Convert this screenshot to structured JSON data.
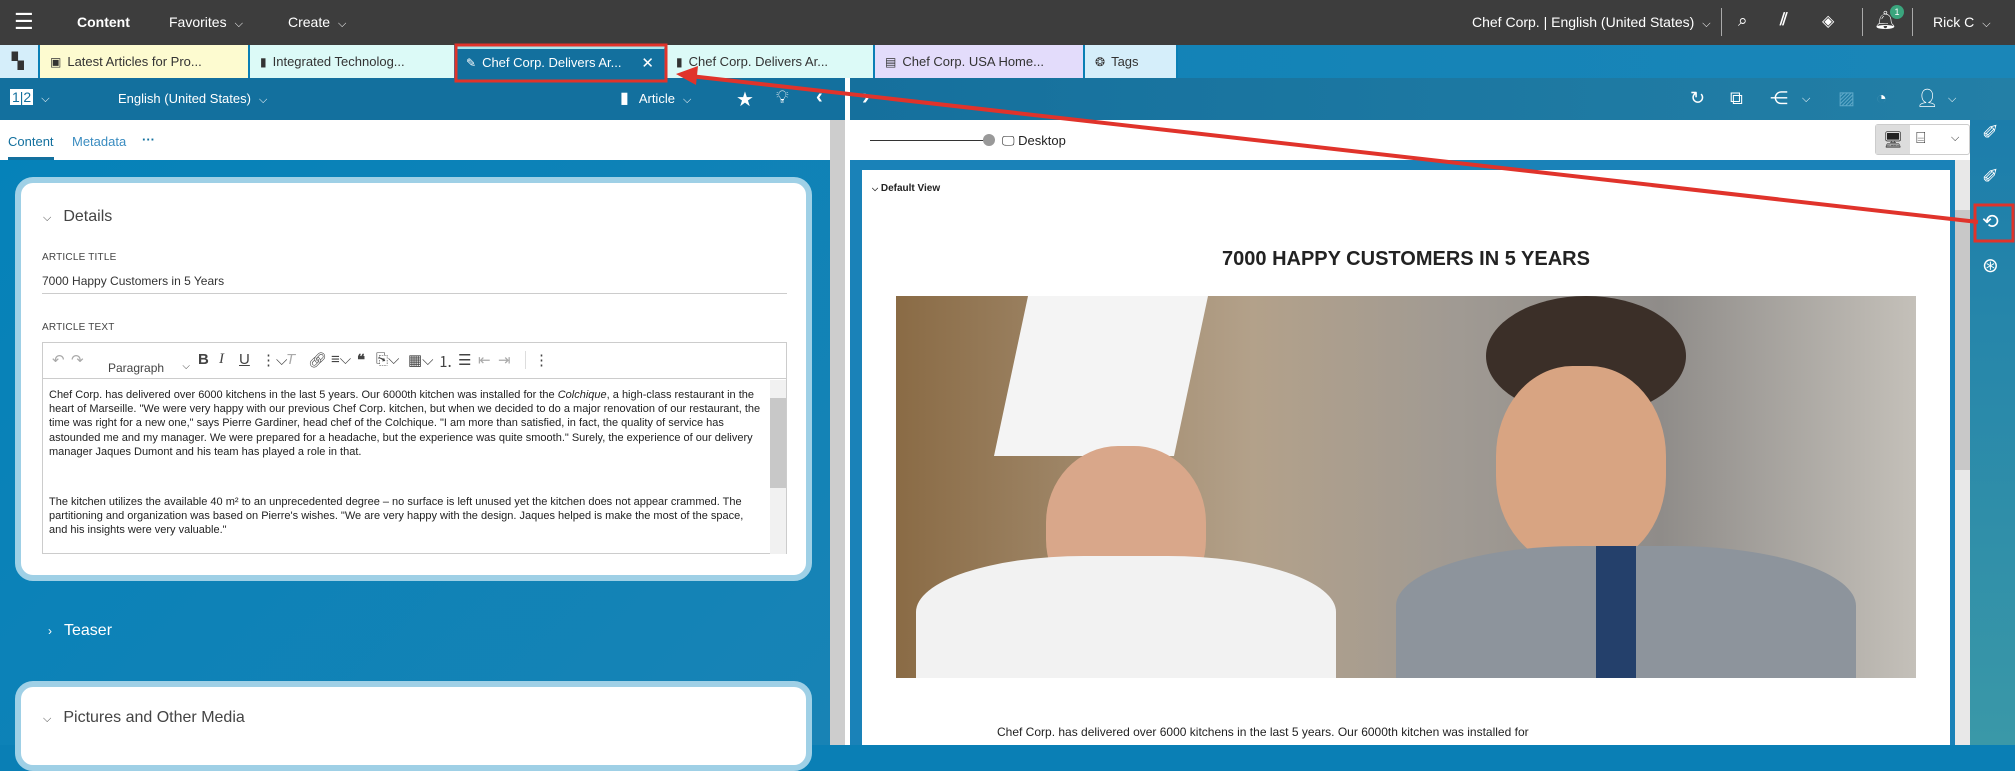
{
  "topbar": {
    "app": "Content",
    "favorites": "Favorites",
    "create": "Create",
    "site": "Chef Corp. | English (United States)",
    "notifications": "1",
    "user": "Rick C"
  },
  "tabs": [
    {
      "label": "Latest Articles for Pro...",
      "color": "#fdfbd0"
    },
    {
      "label": "Integrated Technolog...",
      "color": "#dcfaf7"
    },
    {
      "label": "Chef Corp. Delivers Ar...",
      "color": "#13709e"
    },
    {
      "label": "Chef Corp. Delivers Ar...",
      "color": "#dcfaf7"
    },
    {
      "label": "Chef Corp. USA Home...",
      "color": "#e3dcfb"
    },
    {
      "label": "Tags",
      "color": "#d5eefa"
    }
  ],
  "left_toolbar": {
    "version": "1|2",
    "locale": "English (United States)",
    "doctype": "Article"
  },
  "content_tabs": {
    "content": "Content",
    "metadata": "Metadata",
    "more": "···"
  },
  "details": {
    "heading": "Details",
    "title_label": "ARTICLE TITLE",
    "title_value": "7000 Happy Customers in 5 Years",
    "text_label": "ARTICLE TEXT"
  },
  "editor": {
    "block_format": "Paragraph",
    "para1": "Chef Corp. has delivered over 6000 kitchens in the last 5 years. Our 6000th kitchen was installed for the ",
    "para1_italic": "Colchique",
    "para1_rest": ", a high-class restaurant in the heart of Marseille. \"We were very happy with our previous Chef Corp. kitchen, but when we decided to do a major renovation of our restaurant, the time was right for a new one,\" says Pierre Gardiner, head chef of the Colchique. \"I am more than satisfied, in fact, the quality of service has astounded me and my manager. We were prepared for a headache, but the experience was quite smooth.\" Surely, the experience of our delivery manager Jaques Dumont and his team has played a role in that.",
    "para2": "The kitchen utilizes the available 40 m² to an unprecedented degree – no surface is left unused yet the kitchen does not appear crammed. The partitioning and organization was based on Pierre's wishes. \"We are very happy with the design. Jaques helped is make the most of the space, and his insights were very valuable.\""
  },
  "sections": {
    "teaser": "Teaser",
    "media": "Pictures and Other Media"
  },
  "preview": {
    "device": "Desktop",
    "view": "Default View",
    "heading": "7000 HAPPY CUSTOMERS IN 5 YEARS",
    "body": "Chef Corp. has delivered over 6000 kitchens in the last 5 years. Our 6000th kitchen was installed for"
  },
  "colors": {
    "annotation": "#e0332b",
    "topbar": "#3d3d3d",
    "accent": "#0a7fb5"
  }
}
